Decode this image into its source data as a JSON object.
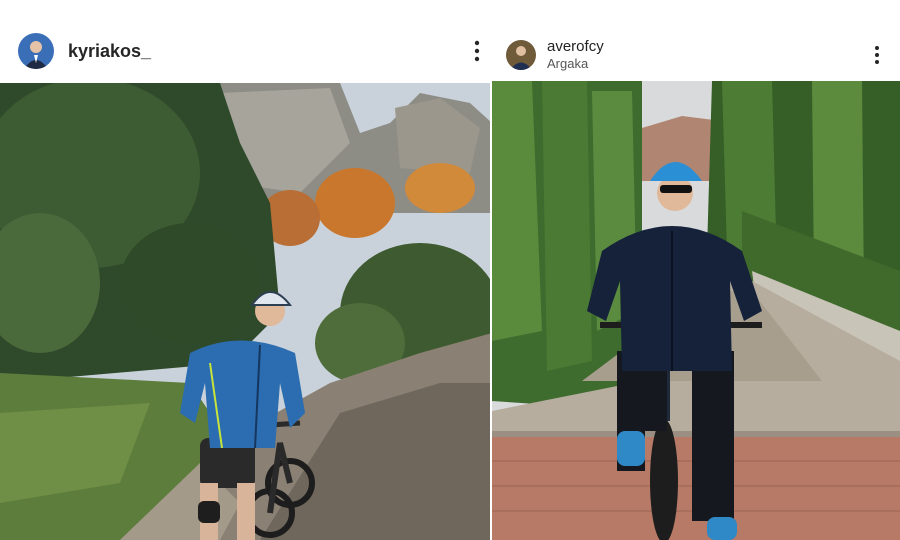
{
  "posts": [
    {
      "username": "kyriakos_",
      "location": "",
      "avatar_icon": "profile-avatar",
      "more_icon": "more-options-vertical-icon",
      "photo": "man-on-mountain-bike-rocky-valley"
    },
    {
      "username": "averofcy",
      "location": "Argaka",
      "avatar_icon": "profile-avatar",
      "more_icon": "more-options-vertical-icon",
      "photo": "man-on-bicycle-cypress-lined-path"
    }
  ],
  "colors": {
    "text_primary": "#262626",
    "text_secondary": "#555555",
    "background": "#ffffff",
    "jacket_left": "#2b6db0",
    "helmet_right": "#2a8fd4"
  }
}
